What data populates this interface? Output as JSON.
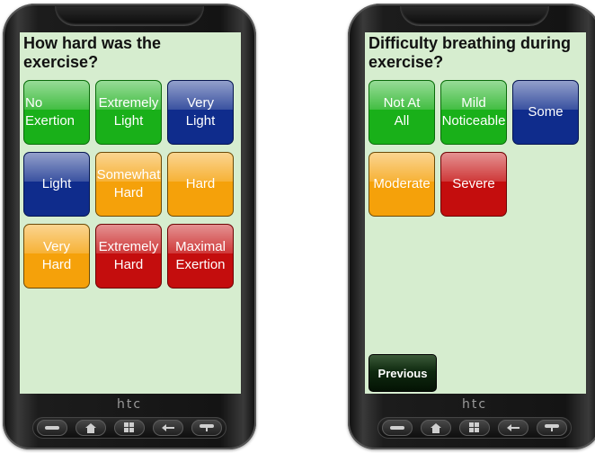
{
  "phones": [
    {
      "brand": "htc",
      "question": "How hard was the exercise?",
      "options": [
        {
          "label": "No\nExertion",
          "color": "green",
          "align": "left"
        },
        {
          "label": "Extremely\nLight",
          "color": "green",
          "align": "center"
        },
        {
          "label": "Very\nLight",
          "color": "blue",
          "align": "center"
        },
        {
          "label": "Light",
          "color": "blue",
          "align": "center"
        },
        {
          "label": "Somewhat\nHard",
          "color": "orange",
          "align": "center"
        },
        {
          "label": "Hard",
          "color": "orange",
          "align": "center"
        },
        {
          "label": "Very\nHard",
          "color": "orange",
          "align": "center"
        },
        {
          "label": "Extremely\nHard",
          "color": "red",
          "align": "center"
        },
        {
          "label": "Maximal\nExertion",
          "color": "red",
          "align": "center"
        }
      ]
    },
    {
      "brand": "htc",
      "question": "Difficulty breathing during exercise?",
      "options": [
        {
          "label": "Not At\nAll",
          "color": "green",
          "align": "center"
        },
        {
          "label": "Mild\nNoticeable",
          "color": "green",
          "align": "center"
        },
        {
          "label": "Some",
          "color": "blue",
          "align": "center"
        },
        {
          "label": "Moderate",
          "color": "orange",
          "align": "center"
        },
        {
          "label": "Severe",
          "color": "red",
          "align": "center"
        }
      ],
      "previous_label": "Previous"
    }
  ],
  "hardware_buttons": [
    "call-icon",
    "home-icon",
    "windows-icon",
    "back-icon",
    "end-call-icon"
  ],
  "colors": {
    "screen_bg": "#d6edcf",
    "green": "#19b019",
    "blue": "#0f2c8c",
    "orange": "#f5a10a",
    "red": "#c40d0d"
  }
}
